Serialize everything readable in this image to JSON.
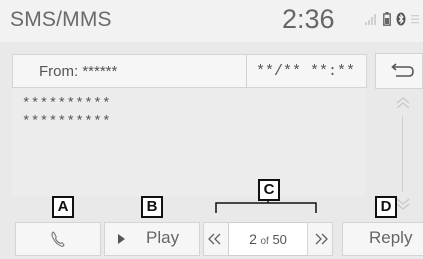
{
  "status_bar": {
    "app_title": "SMS/MMS",
    "time": "2:36",
    "icons": [
      "signal-icon",
      "battery-icon",
      "bluetooth-icon",
      "menu-icon"
    ]
  },
  "message": {
    "from_label": "From: ******",
    "datetime": "**/** **:**",
    "body_lines": [
      "**********",
      "**********"
    ]
  },
  "controls": {
    "play_label": "Play",
    "reply_label": "Reply",
    "page_current": "2",
    "page_of": "of",
    "page_total": "50"
  },
  "callouts": {
    "a": "A",
    "b": "B",
    "c": "C",
    "d": "D"
  }
}
